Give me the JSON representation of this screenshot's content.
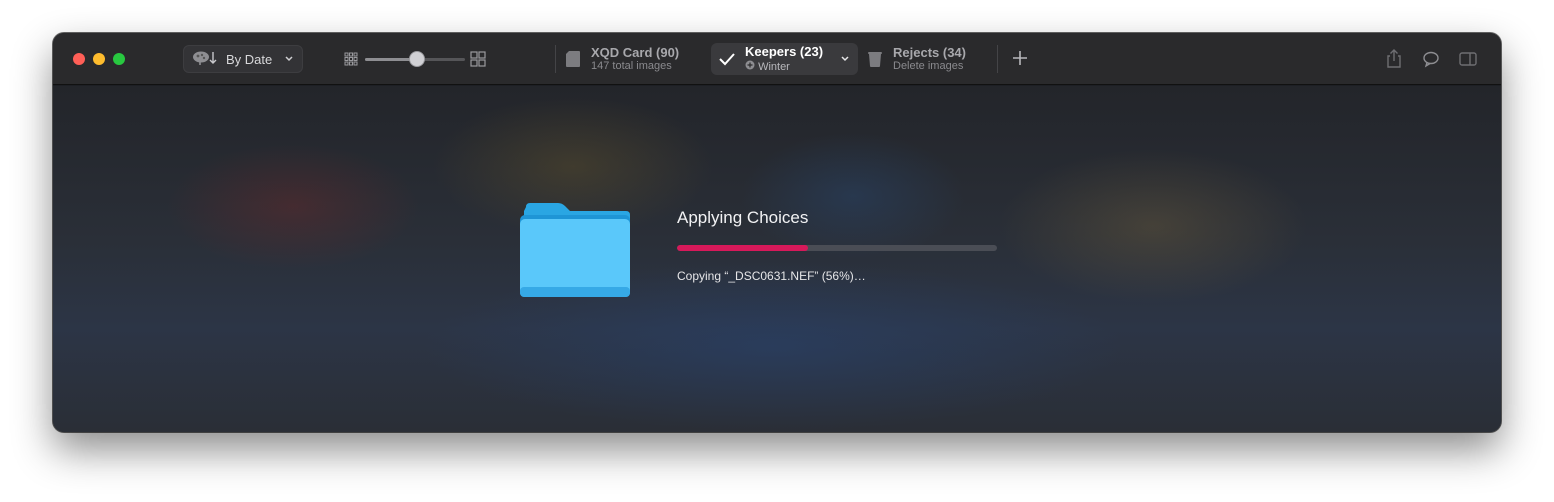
{
  "toolbar": {
    "sort": {
      "label": "By Date"
    },
    "zoom_level": 0.52,
    "destinations": [
      {
        "title": "XQD Card (90)",
        "subtitle": "147 total images",
        "icon": "sd-card-icon",
        "active": false
      },
      {
        "title": "Keepers (23)",
        "subtitle": "Winter",
        "icon": "checkmark-icon",
        "active": true
      },
      {
        "title": "Rejects (34)",
        "subtitle": "Delete images",
        "icon": "trash-icon",
        "active": false
      }
    ],
    "right_icons": [
      "share-icon",
      "comment-icon",
      "sidebar-icon"
    ]
  },
  "progress": {
    "title": "Applying Choices",
    "percent": 0.41,
    "status": "Copying “_DSC0631.NEF” (56%)…",
    "bar_color": "#d6195a"
  },
  "colors": {
    "close": "#ff5f57",
    "minimize": "#febc2e",
    "maximize": "#28c840",
    "folder": "#5ac8fa"
  }
}
